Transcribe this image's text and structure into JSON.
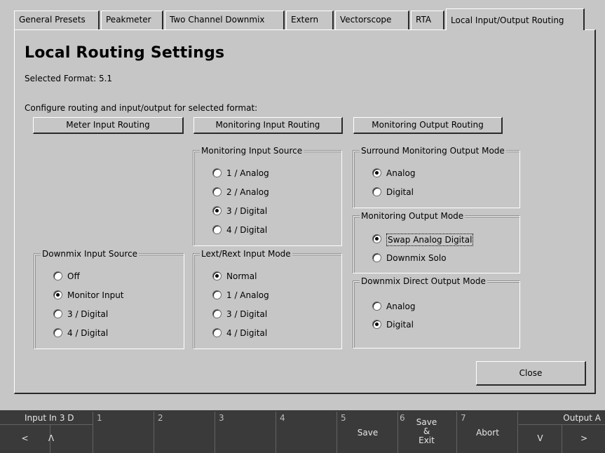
{
  "tabs": [
    "General Presets",
    "Peakmeter",
    "Two Channel Downmix",
    "Extern",
    "Vectorscope",
    "RTA",
    "Local Input/Output Routing"
  ],
  "active_tab_index": 6,
  "page": {
    "title": "Local Routing Settings",
    "selected_format": "Selected Format: 5.1",
    "instruction": "Configure routing and input/output for selected format:"
  },
  "buttons": {
    "meter_input_routing": "Meter Input Routing",
    "monitoring_input_routing": "Monitoring Input Routing",
    "monitoring_output_routing": "Monitoring Output Routing",
    "close": "Close"
  },
  "groups": {
    "monitoring_input_source": {
      "title": "Monitoring Input Source",
      "options": [
        {
          "label": "1 / Analog",
          "selected": false
        },
        {
          "label": "2 / Analog",
          "selected": false
        },
        {
          "label": "3 / Digital",
          "selected": true
        },
        {
          "label": "4 / Digital",
          "selected": false
        }
      ]
    },
    "surround_monitoring_output_mode": {
      "title": "Surround Monitoring Output Mode",
      "options": [
        {
          "label": "Analog",
          "selected": true
        },
        {
          "label": "Digital",
          "selected": false
        }
      ]
    },
    "monitoring_output_mode": {
      "title": "Monitoring Output Mode",
      "options": [
        {
          "label": "Swap Analog Digital",
          "selected": true
        },
        {
          "label": "Downmix Solo",
          "selected": false
        }
      ]
    },
    "downmix_input_source": {
      "title": "Downmix Input Source",
      "options": [
        {
          "label": "Off",
          "selected": false
        },
        {
          "label": "Monitor Input",
          "selected": true
        },
        {
          "label": "3 / Digital",
          "selected": false
        },
        {
          "label": "4 / Digital",
          "selected": false
        }
      ]
    },
    "lext_rext_input_mode": {
      "title": "Lext/Rext Input Mode",
      "options": [
        {
          "label": "Normal",
          "selected": true
        },
        {
          "label": "1 / Analog",
          "selected": false
        },
        {
          "label": "3 / Digital",
          "selected": false
        },
        {
          "label": "4 / Digital",
          "selected": false
        }
      ]
    },
    "downmix_direct_output_mode": {
      "title": "Downmix Direct Output Mode",
      "options": [
        {
          "label": "Analog",
          "selected": false
        },
        {
          "label": "Digital",
          "selected": true
        }
      ]
    }
  },
  "softkeys": {
    "input_label": "Input In 3 D",
    "left_arrow": "<",
    "up_arrow": "Λ",
    "num1": "1",
    "num2": "2",
    "num3": "3",
    "num4": "4",
    "num5": "5",
    "num6": "6",
    "num7": "7",
    "save": "Save",
    "save_exit_1": "Save",
    "save_exit_2": "&",
    "save_exit_3": "Exit",
    "abort": "Abort",
    "output_label": "Output A",
    "down_arrow": "V",
    "right_arrow": ">"
  }
}
